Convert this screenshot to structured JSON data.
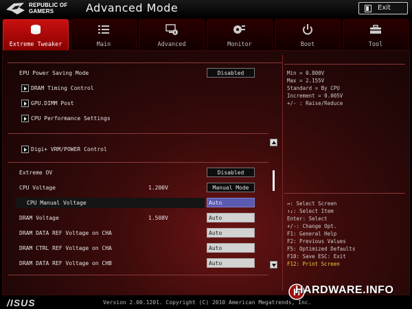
{
  "brand": {
    "line1": "REPUBLIC OF",
    "line2": "GAMERS",
    "footer_logo": "/ISUS"
  },
  "header": {
    "title": "Advanced Mode",
    "exit_label": "Exit"
  },
  "tabs": [
    {
      "label": "Extreme Tweaker",
      "icon": "tweaker-icon",
      "active": true
    },
    {
      "label": "Main",
      "icon": "list-icon"
    },
    {
      "label": "Advanced",
      "icon": "advanced-icon"
    },
    {
      "label": "Monitor",
      "icon": "monitor-icon"
    },
    {
      "label": "Boot",
      "icon": "power-icon"
    },
    {
      "label": "Tool",
      "icon": "tool-icon"
    }
  ],
  "settings": {
    "epu": {
      "label": "EPU Power Saving Mode",
      "value": "Disabled"
    },
    "dram_timing": {
      "label": "DRAM Timing Control"
    },
    "gpu_dimm": {
      "label": "GPU.DIMM Post"
    },
    "cpu_perf": {
      "label": "CPU Performance Settings"
    },
    "digi": {
      "label": "Digi+ VRM/POWER Control"
    },
    "extreme_ov": {
      "label": "Extreme OV",
      "value": "Disabled"
    },
    "cpu_voltage": {
      "label": "CPU Voltage",
      "reading": "1.200V",
      "value": "Manual Mode"
    },
    "cpu_manual": {
      "label": "CPU Manual Voltage",
      "value": "Auto"
    },
    "dram_voltage": {
      "label": "DRAM Voltage",
      "reading": "1.508V",
      "value": "Auto"
    },
    "dram_data_cha": {
      "label": "DRAM DATA REF Voltage on CHA",
      "value": "Auto"
    },
    "dram_ctrl_cha": {
      "label": "DRAM CTRL REF Voltage on CHA",
      "value": "Auto"
    },
    "dram_data_chb": {
      "label": "DRAM DATA REF Voltage on CHB",
      "value": "Auto"
    }
  },
  "info": {
    "min": "Min = 0.800V",
    "max": "Max = 2.155V",
    "standard": "Standard = By CPU",
    "increment": "Increment = 0.005V",
    "raise": "+/- : Raise/Reduce"
  },
  "help": {
    "select_screen": "↔: Select Screen",
    "select_item": "↑↓: Select Item",
    "enter": "Enter: Select",
    "change": "+/-: Change Opt.",
    "f1": "F1: General Help",
    "f2": "F2: Previous Values",
    "f5": "F5: Optimized Defaults",
    "f10": "F10: Save  ESC: Exit",
    "f12": "F12: Print Screen"
  },
  "footer": {
    "version": "Version 2.00.1201. Copyright (C) 2010 American Megatrends, Inc."
  },
  "watermark": "HARDWARE.INFO",
  "colors": {
    "accent": "#c81010",
    "panel": "#2a0808",
    "selected_box": "#5a5ab0",
    "help_highlight": "#f0d040"
  }
}
